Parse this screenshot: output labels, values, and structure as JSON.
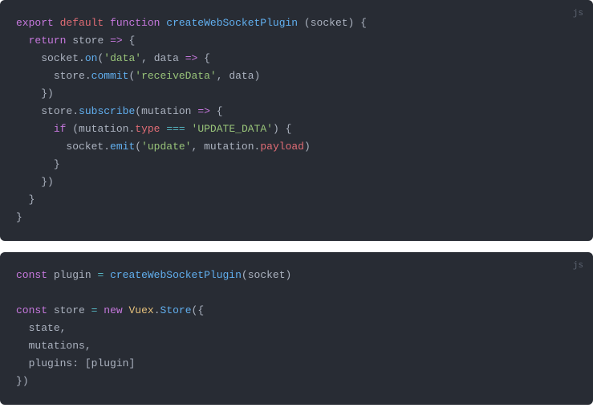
{
  "blocks": [
    {
      "lang": "js",
      "lines": [
        [
          {
            "t": "export",
            "c": "k-export"
          },
          {
            "t": " ",
            "c": ""
          },
          {
            "t": "default",
            "c": "k-default"
          },
          {
            "t": " ",
            "c": ""
          },
          {
            "t": "function",
            "c": "k-function"
          },
          {
            "t": " ",
            "c": ""
          },
          {
            "t": "createWebSocketPlugin",
            "c": "fn-name"
          },
          {
            "t": " ",
            "c": ""
          },
          {
            "t": "(",
            "c": "paren"
          },
          {
            "t": "socket",
            "c": "param"
          },
          {
            "t": ")",
            "c": "paren"
          },
          {
            "t": " ",
            "c": ""
          },
          {
            "t": "{",
            "c": "brace"
          }
        ],
        [
          {
            "t": "  ",
            "c": ""
          },
          {
            "t": "return",
            "c": "k-return"
          },
          {
            "t": " ",
            "c": ""
          },
          {
            "t": "store",
            "c": "param"
          },
          {
            "t": " ",
            "c": ""
          },
          {
            "t": "=>",
            "c": "arrow"
          },
          {
            "t": " ",
            "c": ""
          },
          {
            "t": "{",
            "c": "brace"
          }
        ],
        [
          {
            "t": "    ",
            "c": ""
          },
          {
            "t": "socket",
            "c": "ident"
          },
          {
            "t": ".",
            "c": "punct"
          },
          {
            "t": "on",
            "c": "fn-call"
          },
          {
            "t": "(",
            "c": "paren"
          },
          {
            "t": "'data'",
            "c": "str"
          },
          {
            "t": ",",
            "c": "punct"
          },
          {
            "t": " ",
            "c": ""
          },
          {
            "t": "data",
            "c": "param"
          },
          {
            "t": " ",
            "c": ""
          },
          {
            "t": "=>",
            "c": "arrow"
          },
          {
            "t": " ",
            "c": ""
          },
          {
            "t": "{",
            "c": "brace"
          }
        ],
        [
          {
            "t": "      ",
            "c": ""
          },
          {
            "t": "store",
            "c": "ident"
          },
          {
            "t": ".",
            "c": "punct"
          },
          {
            "t": "commit",
            "c": "fn-call"
          },
          {
            "t": "(",
            "c": "paren"
          },
          {
            "t": "'receiveData'",
            "c": "str"
          },
          {
            "t": ",",
            "c": "punct"
          },
          {
            "t": " ",
            "c": ""
          },
          {
            "t": "data",
            "c": "ident"
          },
          {
            "t": ")",
            "c": "paren"
          }
        ],
        [
          {
            "t": "    ",
            "c": ""
          },
          {
            "t": "}",
            "c": "brace"
          },
          {
            "t": ")",
            "c": "paren"
          }
        ],
        [
          {
            "t": "    ",
            "c": ""
          },
          {
            "t": "store",
            "c": "ident"
          },
          {
            "t": ".",
            "c": "punct"
          },
          {
            "t": "subscribe",
            "c": "fn-call"
          },
          {
            "t": "(",
            "c": "paren"
          },
          {
            "t": "mutation",
            "c": "param"
          },
          {
            "t": " ",
            "c": ""
          },
          {
            "t": "=>",
            "c": "arrow"
          },
          {
            "t": " ",
            "c": ""
          },
          {
            "t": "{",
            "c": "brace"
          }
        ],
        [
          {
            "t": "      ",
            "c": ""
          },
          {
            "t": "if",
            "c": "k-if"
          },
          {
            "t": " ",
            "c": ""
          },
          {
            "t": "(",
            "c": "paren"
          },
          {
            "t": "mutation",
            "c": "ident"
          },
          {
            "t": ".",
            "c": "punct"
          },
          {
            "t": "type",
            "c": "prop"
          },
          {
            "t": " ",
            "c": ""
          },
          {
            "t": "===",
            "c": "op"
          },
          {
            "t": " ",
            "c": ""
          },
          {
            "t": "'UPDATE_DATA'",
            "c": "str"
          },
          {
            "t": ")",
            "c": "paren"
          },
          {
            "t": " ",
            "c": ""
          },
          {
            "t": "{",
            "c": "brace"
          }
        ],
        [
          {
            "t": "        ",
            "c": ""
          },
          {
            "t": "socket",
            "c": "ident"
          },
          {
            "t": ".",
            "c": "punct"
          },
          {
            "t": "emit",
            "c": "fn-call"
          },
          {
            "t": "(",
            "c": "paren"
          },
          {
            "t": "'update'",
            "c": "str"
          },
          {
            "t": ",",
            "c": "punct"
          },
          {
            "t": " ",
            "c": ""
          },
          {
            "t": "mutation",
            "c": "ident"
          },
          {
            "t": ".",
            "c": "punct"
          },
          {
            "t": "payload",
            "c": "prop"
          },
          {
            "t": ")",
            "c": "paren"
          }
        ],
        [
          {
            "t": "      ",
            "c": ""
          },
          {
            "t": "}",
            "c": "brace"
          }
        ],
        [
          {
            "t": "    ",
            "c": ""
          },
          {
            "t": "}",
            "c": "brace"
          },
          {
            "t": ")",
            "c": "paren"
          }
        ],
        [
          {
            "t": "  ",
            "c": ""
          },
          {
            "t": "}",
            "c": "brace"
          }
        ],
        [
          {
            "t": "}",
            "c": "brace"
          }
        ]
      ]
    },
    {
      "lang": "js",
      "lines": [
        [
          {
            "t": "const",
            "c": "k-const"
          },
          {
            "t": " ",
            "c": ""
          },
          {
            "t": "plugin",
            "c": "ident"
          },
          {
            "t": " ",
            "c": ""
          },
          {
            "t": "=",
            "c": "op"
          },
          {
            "t": " ",
            "c": ""
          },
          {
            "t": "createWebSocketPlugin",
            "c": "fn-call"
          },
          {
            "t": "(",
            "c": "paren"
          },
          {
            "t": "socket",
            "c": "ident"
          },
          {
            "t": ")",
            "c": "paren"
          }
        ],
        [
          {
            "t": "",
            "c": ""
          }
        ],
        [
          {
            "t": "const",
            "c": "k-const"
          },
          {
            "t": " ",
            "c": ""
          },
          {
            "t": "store",
            "c": "ident"
          },
          {
            "t": " ",
            "c": ""
          },
          {
            "t": "=",
            "c": "op"
          },
          {
            "t": " ",
            "c": ""
          },
          {
            "t": "new",
            "c": "k-new"
          },
          {
            "t": " ",
            "c": ""
          },
          {
            "t": "Vuex",
            "c": "obj"
          },
          {
            "t": ".",
            "c": "punct"
          },
          {
            "t": "Store",
            "c": "fn-call"
          },
          {
            "t": "(",
            "c": "paren"
          },
          {
            "t": "{",
            "c": "brace"
          }
        ],
        [
          {
            "t": "  ",
            "c": ""
          },
          {
            "t": "state",
            "c": "attrkey"
          },
          {
            "t": ",",
            "c": "punct"
          }
        ],
        [
          {
            "t": "  ",
            "c": ""
          },
          {
            "t": "mutations",
            "c": "attrkey"
          },
          {
            "t": ",",
            "c": "punct"
          }
        ],
        [
          {
            "t": "  ",
            "c": ""
          },
          {
            "t": "plugins",
            "c": "attrkey"
          },
          {
            "t": ":",
            "c": "punct"
          },
          {
            "t": " ",
            "c": ""
          },
          {
            "t": "[",
            "c": "paren"
          },
          {
            "t": "plugin",
            "c": "ident"
          },
          {
            "t": "]",
            "c": "paren"
          }
        ],
        [
          {
            "t": "}",
            "c": "brace"
          },
          {
            "t": ")",
            "c": "paren"
          }
        ]
      ]
    }
  ]
}
